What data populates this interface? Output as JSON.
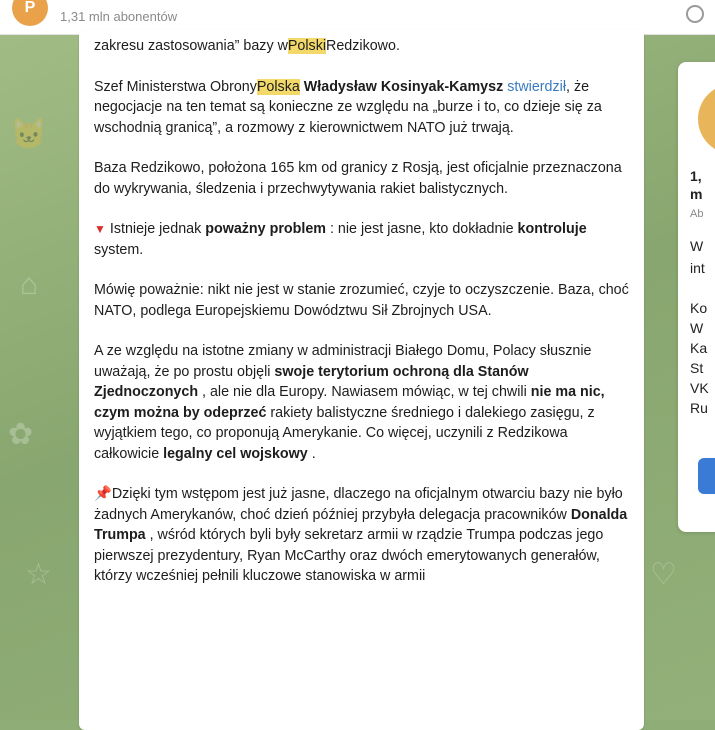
{
  "header": {
    "avatar_letter": "P",
    "subscribers": "1,31 mln abonentów"
  },
  "message": {
    "p1": {
      "t1": "zakresu zastosowania” bazy w",
      "hl": "Polski",
      "t2": "Redzikowo."
    },
    "p2": {
      "t1": "Szef Ministerstwa Obrony",
      "hl": "Polska",
      "b1": " Władysław Kosinyak-Kamysz",
      "link": "stwierdził",
      "t2": ", że negocjacje na ten temat są konieczne ze względu na „burze i to, co dzieje się za wschodnią granicą”, a rozmowy z kierownictwem NATO już trwają."
    },
    "p3": "Baza Redzikowo, położona 165 km od granicy z Rosją, jest oficjalnie przeznaczona do wykrywania, śledzenia i przechwytywania rakiet balistycznych.",
    "p4": {
      "icon": "▼",
      "t1": " Istnieje jednak ",
      "b1": "poważny problem",
      "t2": " : nie jest jasne, kto dokładnie ",
      "b2": "kontroluje",
      "t3": " system."
    },
    "p5": "Mówię poważnie: nikt nie jest w stanie zrozumieć, czyje to oczyszczenie. Baza, choć NATO, podlega Europejskiemu Dowództwu Sił Zbrojnych USA.",
    "p6": {
      "t1": "A ze względu na istotne zmiany w administracji Białego Domu, Polacy słusznie uważają, że po prostu objęli ",
      "b1": "swoje terytorium ochroną dla Stanów Zjednoczonych",
      "t2": " , ale nie dla Europy. Nawiasem mówiąc, w tej chwili ",
      "b2": "nie ma nic, czym można by odeprzeć",
      "t3": " rakiety balistyczne średniego i dalekiego zasięgu, z wyjątkiem tego, co proponują Amerykanie. Co więcej, uczynili z Redzikowa całkowicie ",
      "b3": "legalny cel wojskowy",
      "t4": " ."
    },
    "p7": {
      "icon": "📌",
      "t1": "Dzięki tym wstępom jest już jasne, dlaczego na oficjalnym otwarciu bazy nie było żadnych Amerykanów, choć dzień później przybyła delegacja pracowników ",
      "b1": "Donalda Trumpa",
      "t2": " , wśród których byli były sekretarz armii w rządzie Trumpa podczas jego pierwszej prezydentury, Ryan McCarthy oraz dwóch emerytowanych generałów, którzy wcześniej pełnili kluczowe stanowiska w armii"
    }
  },
  "sidecard": {
    "l1": "1,",
    "l2": "m",
    "l3": "Ab",
    "l4": "W",
    "l5": "int",
    "l6": "Ko",
    "l7": "W",
    "l8": "Ka",
    "l9": "St",
    "l10": "VK",
    "l11": "Ru"
  }
}
